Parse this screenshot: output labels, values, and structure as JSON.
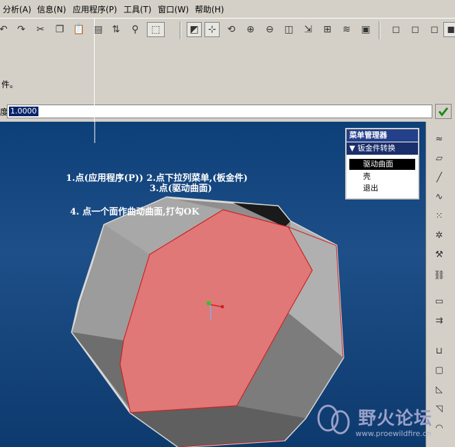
{
  "menubar": {
    "items": [
      "分析(A)",
      "信息(N)",
      "应用程序(P)",
      "工具(T)",
      "窗口(W)",
      "帮助(H)"
    ]
  },
  "toolbar": {
    "icons": [
      "undo-icon",
      "redo-icon",
      "cut-icon",
      "copy-icon",
      "paste-icon",
      "paste-special-icon",
      "regenerate-icon",
      "find-icon",
      "select-box-icon",
      "repaint-icon",
      "spin-center-icon",
      "orient-icon",
      "zoom-in-icon",
      "zoom-out-icon",
      "refit-icon",
      "reorient-icon",
      "saved-views-icon",
      "layers-icon",
      "model-display-icon",
      "wireframe-icon",
      "hidden-line-icon",
      "no-hidden-icon",
      "shading-icon"
    ]
  },
  "message": {
    "text": "件。"
  },
  "input": {
    "label": "度",
    "value": "1.0000"
  },
  "annotations": {
    "step1": "1.点(应用程序(P))   2.点下拉列菜单,(板金件)",
    "step3": "3.点(驱动曲面)",
    "step4": "4. 点一个面作曲动曲面,打勾OK"
  },
  "menu_manager": {
    "title": "菜单管理器",
    "submenu": "钣金件转换",
    "options": [
      "驱动曲面",
      "壳",
      "退出"
    ]
  },
  "right_toolbar": {
    "icons": [
      "sketched-curve-icon",
      "datum-plane-icon",
      "datum-axis-icon",
      "datum-curve-icon",
      "datum-point-icon",
      "coordinate-system-icon",
      "analysis-icon",
      "datum-csys-icon",
      "edit-tool-icon",
      "mirror-icon",
      "wall-icon",
      "extrude-icon",
      "bend-icon",
      "form-icon",
      "unbend-icon"
    ]
  },
  "watermark": {
    "name": "野火论坛",
    "url": "www.proewildfire.cn"
  },
  "colors": {
    "selection_fill": "#e07878",
    "selection_edge": "#d02020",
    "gray_face": "#9a9a9a",
    "viewport_bg": "#1a4a84"
  }
}
